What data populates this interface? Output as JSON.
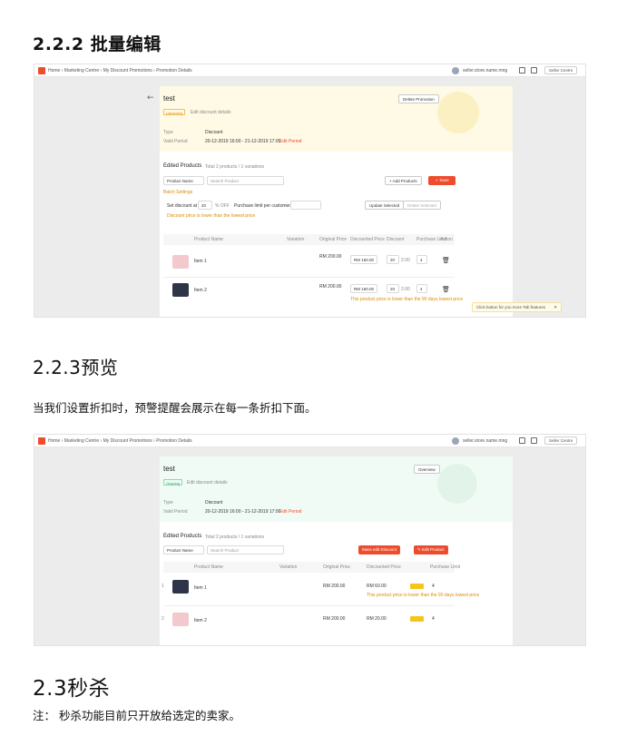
{
  "doc": {
    "heading_batch": "2.2.2 批量编辑",
    "heading_preview": "2.2.3预览",
    "preview_text": "当我们设置折扣时，预警提醒会展示在每一条折扣下面。",
    "heading_flash": "2.3秒杀",
    "flash_note": "注： 秒杀功能目前只开放给选定的卖家。"
  },
  "shot1": {
    "breadcrumb": "Home › Marketing Centre › My Discount Promotions › Promotion Details",
    "user": "seller.store.name.mng",
    "right_pill": "Seller Centre",
    "promo_name": "test",
    "status_badge": "Upcoming",
    "status_note": "Edit discount details",
    "delete_button": "Delete Promotion",
    "type_label": "Type",
    "type_value": "Discount",
    "period_label": "Valid Period",
    "period_value": "20-12-2019 16:00 - 21-12-2019 17:00",
    "edit_period": "Edit Period",
    "products_title": "Edited Products",
    "products_hint": "Total 2 products / 1 variations",
    "filter_select": "Product Name",
    "search_placeholder": "Search Product",
    "add_products": "+ Add Products",
    "save_button": "✓ Save",
    "batch_label": "Batch Settings",
    "discount_label": "Set discount at",
    "discount_value": "20",
    "discount_unit": "% OFF",
    "limit_label": "Purchase limit per customer at",
    "batch_warning": "Discount price is lower than the lowest price",
    "update_button": "Update Selected",
    "delete_selected": "Delete Selected",
    "col_product": "Product Name",
    "col_variation": "Variation",
    "col_original": "Original Price",
    "col_discounted": "Discounted Price",
    "col_discount": "Discount",
    "col_limit": "Purchase Limit",
    "col_action": "Action",
    "rows": [
      {
        "name": "Item 1",
        "price": "RM 200.00",
        "disc_price": "RM 160.00",
        "disc_pct": "20",
        "limit": "2.00",
        "qty": "4",
        "warning": ""
      },
      {
        "name": "Item 2",
        "price": "RM 200.00",
        "disc_price": "RM 160.00",
        "disc_pct": "20",
        "limit": "2.00",
        "qty": "4",
        "warning": "This product price is lower than the 90 days lowest price"
      }
    ],
    "tip_text": "Click button for you more Tab features",
    "tip_close": "✕"
  },
  "shot2": {
    "breadcrumb": "Home › Marketing Centre › My Discount Promotions › Promotion Details",
    "user": "seller.store.name.mng",
    "right_pill": "Seller Centre",
    "promo_name": "test",
    "status_badge": "Ongoing",
    "status_note": "Edit discount details",
    "overview_button": "Overview",
    "type_label": "Type",
    "type_value": "Discount",
    "period_label": "Valid Period",
    "period_value": "20-12-2019 16:00 - 21-12-2019 17:00",
    "edit_period": "Edit Period",
    "products_title": "Edited Products",
    "products_hint": "Total 2 products / 1 variations",
    "filter_select": "Product Name",
    "search_placeholder": "Search Product",
    "mass_edit": "Mass edit Discount",
    "edit_product": "✎ Edit Product",
    "col_product": "Product Name",
    "col_variation": "Variation",
    "col_original": "Original Price",
    "col_discounted": "Discounted Price",
    "col_limit": "Purchase Limit",
    "rows": [
      {
        "name": "Item 1",
        "price": "RM 200.00",
        "disc_price": "RM 60.00",
        "qty": "4",
        "warning": "This product price is lower than the 90 days lowest price"
      },
      {
        "name": "Item 2",
        "price": "RM 200.00",
        "disc_price": "RM 20.00",
        "qty": "4",
        "warning": ""
      }
    ]
  },
  "colors": {
    "brand": "#ee4d2d",
    "warn_bg": "#fffae6",
    "ok_bg": "#f1fbf6",
    "badge": "#f5c518"
  }
}
